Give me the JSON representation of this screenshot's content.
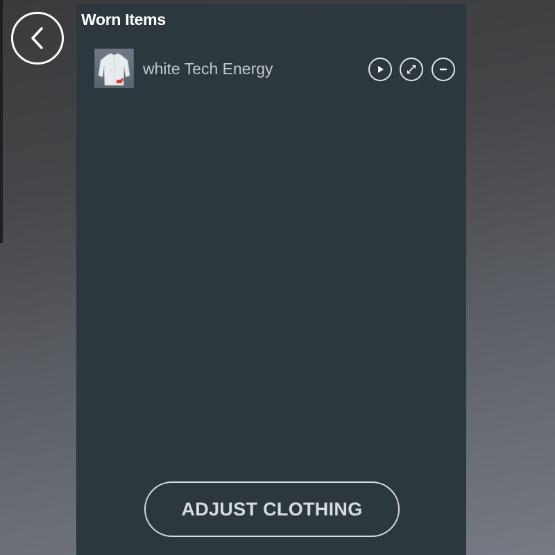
{
  "back": {
    "icon": "chevron-left-icon"
  },
  "panel": {
    "title": "Worn Items",
    "background": "#2d373e"
  },
  "worn_items": [
    {
      "name": "white Tech Energy",
      "thumbnail": "white-shirt-thumbnail",
      "actions": [
        {
          "icon": "play-icon"
        },
        {
          "icon": "resize-arrows-icon"
        },
        {
          "icon": "minus-icon"
        }
      ]
    }
  ],
  "footer": {
    "adjust_label": "ADJUST CLOTHING"
  }
}
